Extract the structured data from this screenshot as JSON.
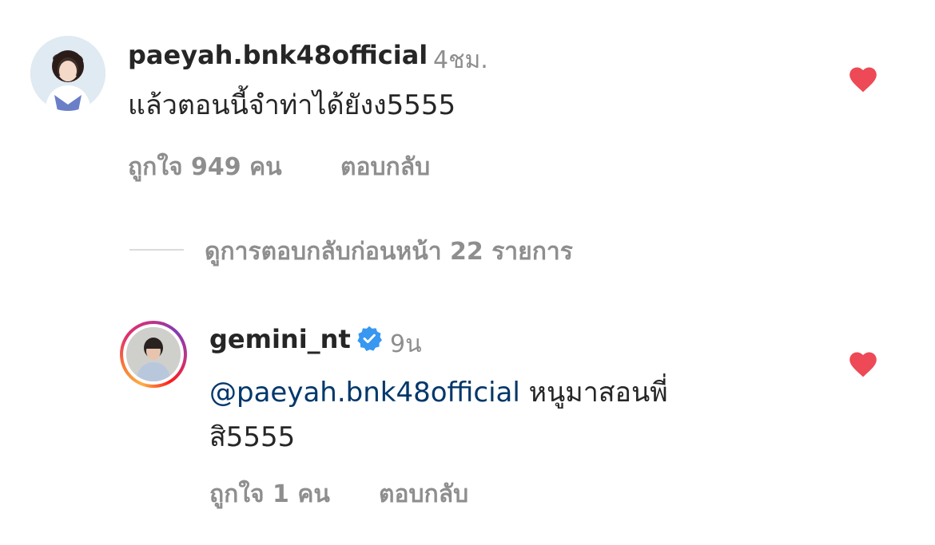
{
  "comments": [
    {
      "username": "paeyah.bnk48official",
      "time": "4ชม.",
      "text": "แล้วตอนนี้จำท่าได้ยังง5555",
      "likes": "ถูกใจ 949 คน",
      "reply_label": "ตอบกลับ",
      "liked": true
    }
  ],
  "view_replies": "ดูการตอบกลับก่อนหน้า 22 รายการ",
  "reply": {
    "username": "gemini_nt",
    "verified": true,
    "time": "9น",
    "mention": "@paeyah.bnk48official",
    "text_line1": "หนูมาสอนพี่",
    "text_line2": "สิ5555",
    "likes": "ถูกใจ 1 คน",
    "reply_label": "ตอบกลับ",
    "liked": true
  },
  "colors": {
    "heart": "#ed4956",
    "verified": "#3897f0",
    "mention": "#00376b",
    "secondary_text": "#8e8e8e"
  },
  "icons": {
    "heart": "heart-filled-icon",
    "verified": "verified-badge-icon"
  }
}
